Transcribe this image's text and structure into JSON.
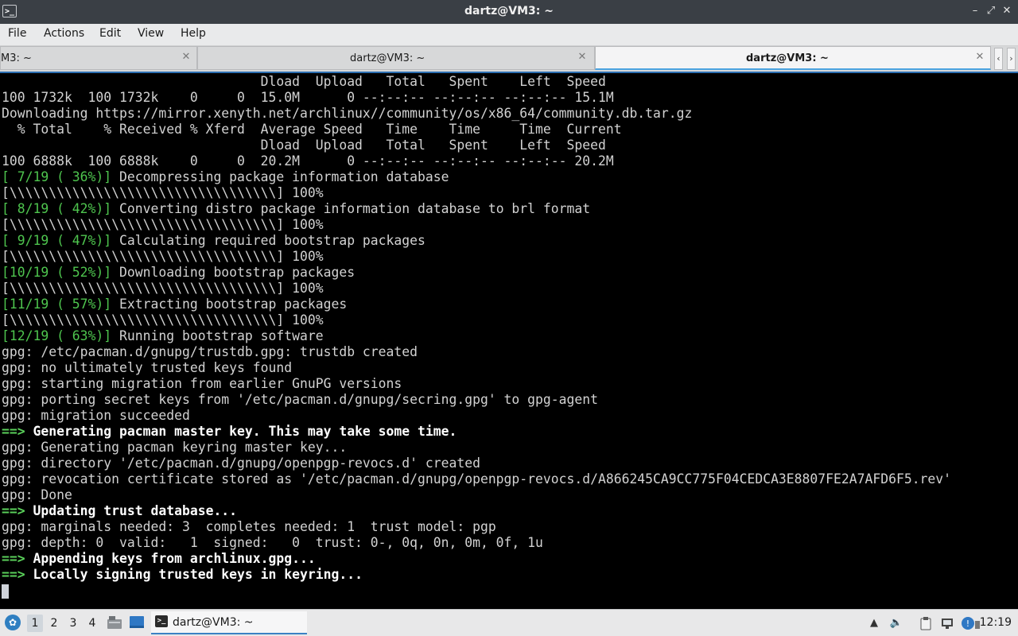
{
  "window": {
    "title": "dartz@VM3: ~"
  },
  "menu": [
    "File",
    "Actions",
    "Edit",
    "View",
    "Help"
  ],
  "tabs": [
    {
      "label": "M3: ~"
    },
    {
      "label": "dartz@VM3: ~"
    },
    {
      "label": "dartz@VM3: ~"
    }
  ],
  "terminal": {
    "lines": [
      [
        {
          "t": "                                 Dload  Upload   Total   Spent    Left  Speed"
        }
      ],
      [
        {
          "t": "100 1732k  100 1732k    0     0  15.0M      0 --:--:-- --:--:-- --:--:-- 15.1M"
        }
      ],
      [
        {
          "t": "Downloading https://mirror.xenyth.net/archlinux//community/os/x86_64/community.db.tar.gz"
        }
      ],
      [
        {
          "t": "  % Total    % Received % Xferd  Average Speed   Time    Time     Time  Current"
        }
      ],
      [
        {
          "t": "                                 Dload  Upload   Total   Spent    Left  Speed"
        }
      ],
      [
        {
          "t": "100 6888k  100 6888k    0     0  20.2M      0 --:--:-- --:--:-- --:--:-- 20.2M"
        }
      ],
      [
        {
          "t": "[ 7/19 ( 36%)]",
          "c": "green"
        },
        {
          "t": " Decompressing package information database"
        }
      ],
      [
        {
          "t": "[\\\\\\\\\\\\\\\\\\\\\\\\\\\\\\\\\\\\\\\\\\\\\\\\\\\\\\\\\\\\\\\\\\\\] 100%"
        }
      ],
      [
        {
          "t": "[ 8/19 ( 42%)]",
          "c": "green"
        },
        {
          "t": " Converting distro package information database to brl format"
        }
      ],
      [
        {
          "t": "[\\\\\\\\\\\\\\\\\\\\\\\\\\\\\\\\\\\\\\\\\\\\\\\\\\\\\\\\\\\\\\\\\\\\] 100%"
        }
      ],
      [
        {
          "t": "[ 9/19 ( 47%)]",
          "c": "green"
        },
        {
          "t": " Calculating required bootstrap packages"
        }
      ],
      [
        {
          "t": "[\\\\\\\\\\\\\\\\\\\\\\\\\\\\\\\\\\\\\\\\\\\\\\\\\\\\\\\\\\\\\\\\\\\\] 100%"
        }
      ],
      [
        {
          "t": "[10/19 ( 52%)]",
          "c": "green"
        },
        {
          "t": " Downloading bootstrap packages"
        }
      ],
      [
        {
          "t": "[\\\\\\\\\\\\\\\\\\\\\\\\\\\\\\\\\\\\\\\\\\\\\\\\\\\\\\\\\\\\\\\\\\\\] 100%"
        }
      ],
      [
        {
          "t": "[11/19 ( 57%)]",
          "c": "green"
        },
        {
          "t": " Extracting bootstrap packages"
        }
      ],
      [
        {
          "t": "[\\\\\\\\\\\\\\\\\\\\\\\\\\\\\\\\\\\\\\\\\\\\\\\\\\\\\\\\\\\\\\\\\\\\] 100%"
        }
      ],
      [
        {
          "t": "[12/19 ( 63%)]",
          "c": "green"
        },
        {
          "t": " Running bootstrap software"
        }
      ],
      [
        {
          "t": "gpg: /etc/pacman.d/gnupg/trustdb.gpg: trustdb created"
        }
      ],
      [
        {
          "t": "gpg: no ultimately trusted keys found"
        }
      ],
      [
        {
          "t": "gpg: starting migration from earlier GnuPG versions"
        }
      ],
      [
        {
          "t": "gpg: porting secret keys from '/etc/pacman.d/gnupg/secring.gpg' to gpg-agent"
        }
      ],
      [
        {
          "t": "gpg: migration succeeded"
        }
      ],
      [
        {
          "t": "==>",
          "c": "arrow"
        },
        {
          "t": " Generating pacman master key. This may take some time.",
          "c": "wbold"
        }
      ],
      [
        {
          "t": "gpg: Generating pacman keyring master key..."
        }
      ],
      [
        {
          "t": "gpg: directory '/etc/pacman.d/gnupg/openpgp-revocs.d' created"
        }
      ],
      [
        {
          "t": "gpg: revocation certificate stored as '/etc/pacman.d/gnupg/openpgp-revocs.d/A866245CA9CC775F04CEDCA3E8807FE2A7AFD6F5.rev'"
        }
      ],
      [
        {
          "t": "gpg: Done"
        }
      ],
      [
        {
          "t": "==>",
          "c": "arrow"
        },
        {
          "t": " Updating trust database...",
          "c": "wbold"
        }
      ],
      [
        {
          "t": "gpg: marginals needed: 3  completes needed: 1  trust model: pgp"
        }
      ],
      [
        {
          "t": "gpg: depth: 0  valid:   1  signed:   0  trust: 0-, 0q, 0n, 0m, 0f, 1u"
        }
      ],
      [
        {
          "t": "==>",
          "c": "arrow"
        },
        {
          "t": " Appending keys from archlinux.gpg...",
          "c": "wbold"
        }
      ],
      [
        {
          "t": "==>",
          "c": "arrow"
        },
        {
          "t": " Locally signing trusted keys in keyring...",
          "c": "wbold"
        }
      ]
    ]
  },
  "taskbar": {
    "workspaces": [
      "1",
      "2",
      "3",
      "4"
    ],
    "task_label": "dartz@VM3: ~",
    "clock": "12:19"
  },
  "colors": {
    "accent": "#3b82c4",
    "terminal_bg": "#000000",
    "terminal_fg": "#d2d2d2",
    "progress_green": "#4ec54e"
  },
  "icons": {
    "window": "terminal-icon",
    "taskbar": [
      "start-menu-icon",
      "file-manager-icon",
      "show-desktop-icon",
      "terminal-icon"
    ],
    "tray": [
      "tray-hide-icon",
      "volume-icon",
      "clipboard-icon",
      "network-icon",
      "update-icon",
      "power-icon"
    ]
  }
}
